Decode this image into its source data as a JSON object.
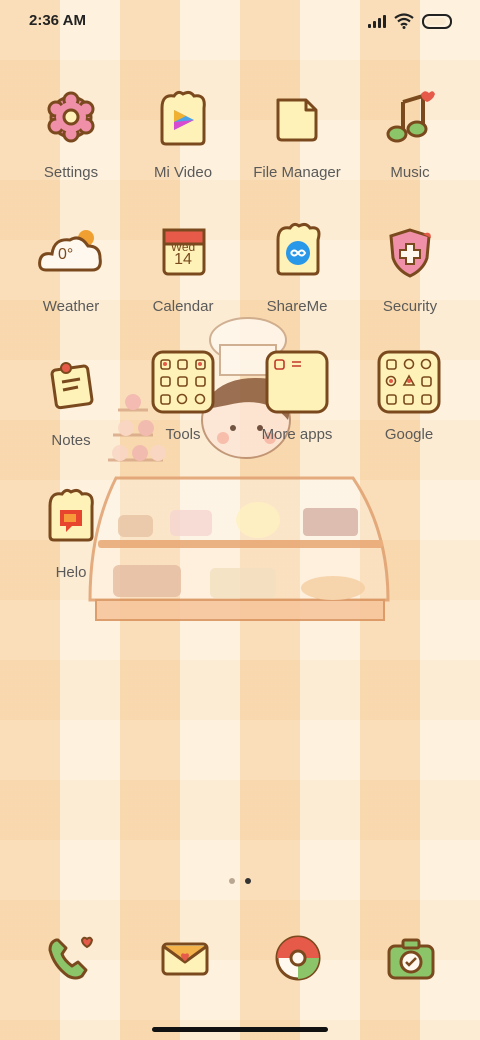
{
  "status_bar": {
    "time": "2:36 AM"
  },
  "apps": [
    {
      "label": "Settings",
      "icon": "gear-icon"
    },
    {
      "label": "Mi Video",
      "icon": "video-icon"
    },
    {
      "label": "File Manager",
      "icon": "folder-icon"
    },
    {
      "label": "Music",
      "icon": "music-icon"
    },
    {
      "label": "Weather",
      "icon": "cloud-icon",
      "temp": "0°"
    },
    {
      "label": "Calendar",
      "icon": "calendar-icon",
      "day_name": "Wed",
      "day_num": "14"
    },
    {
      "label": "ShareMe",
      "icon": "share-icon"
    },
    {
      "label": "Security",
      "icon": "shield-icon"
    },
    {
      "label": "Notes",
      "icon": "note-icon"
    },
    {
      "label": "Tools",
      "icon": "folder-grid-icon"
    },
    {
      "label": "More apps",
      "icon": "folder-grid-icon"
    },
    {
      "label": "Google",
      "icon": "folder-grid-icon"
    },
    {
      "label": "Helo",
      "icon": "helo-icon"
    }
  ],
  "pager": {
    "pages": 2,
    "active": 2
  },
  "dock": [
    {
      "icon": "phone-icon"
    },
    {
      "icon": "message-icon"
    },
    {
      "icon": "browser-icon"
    },
    {
      "icon": "camera-icon"
    }
  ],
  "colors": {
    "outline": "#7a4a1e",
    "cream": "#fff2b8",
    "pink": "#f08fa8",
    "green": "#8cc46a",
    "red": "#e65a4a"
  }
}
